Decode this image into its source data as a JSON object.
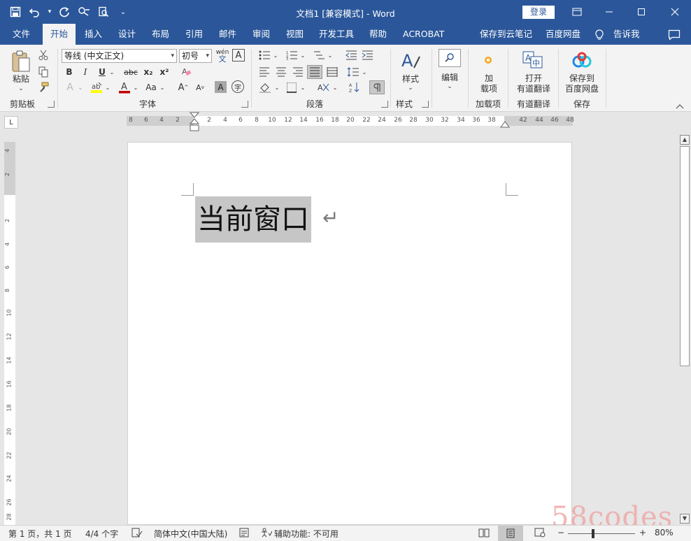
{
  "titlebar": {
    "title": "文档1 [兼容模式]  -  Word",
    "login_label": "登录",
    "qat_icons": [
      "save-icon",
      "undo-icon",
      "redo-icon",
      "touch-mode-icon",
      "print-preview-icon",
      "customize-qat-icon"
    ]
  },
  "tabs": [
    "文件",
    "开始",
    "插入",
    "设计",
    "布局",
    "引用",
    "邮件",
    "审阅",
    "视图",
    "开发工具",
    "帮助",
    "ACROBAT",
    "保存到云笔记",
    "百度网盘",
    "告诉我"
  ],
  "active_tab": "开始",
  "ribbon": {
    "clipboard": {
      "label": "剪贴板",
      "paste_label": "粘贴"
    },
    "font": {
      "label": "字体",
      "font_name": "等线 (中文正文)",
      "font_size": "初号",
      "bold": "B",
      "italic": "I",
      "underline": "U",
      "strike": "abc",
      "subscript": "x₂",
      "superscript": "x²",
      "change_case": "Aa",
      "grow": "A",
      "shrink": "A",
      "phonetic": "wén",
      "char_border": "A",
      "char_shade": "A",
      "enclose": "字"
    },
    "paragraph": {
      "label": "段落"
    },
    "styles": {
      "label": "样式",
      "button": "样式"
    },
    "editing": {
      "label": "编辑"
    },
    "addins": {
      "label": "加载项",
      "button_line1": "加",
      "button_line2": "载项"
    },
    "youdao": {
      "label": "有道翻译",
      "button_line1": "打开",
      "button_line2": "有道翻译"
    },
    "save": {
      "label": "保存",
      "button_line1": "保存到",
      "button_line2": "百度网盘"
    }
  },
  "ruler": {
    "tab_selector": "L",
    "h_numbers": [
      "8",
      "6",
      "4",
      "2",
      "2",
      "4",
      "6",
      "8",
      "10",
      "12",
      "14",
      "16",
      "18",
      "20",
      "22",
      "24",
      "26",
      "28",
      "30",
      "32",
      "34",
      "36",
      "38",
      "42",
      "44",
      "46",
      "48"
    ],
    "v_numbers": [
      "4",
      "2",
      "2",
      "4",
      "6",
      "8",
      "10",
      "12",
      "14",
      "16",
      "18",
      "20",
      "22",
      "24",
      "26",
      "28"
    ]
  },
  "document": {
    "text": "当前窗口",
    "paragraph_mark": "↵"
  },
  "status": {
    "page": "第 1 页，共 1 页",
    "words": "4/4 个字",
    "language": "简体中文(中国大陆)",
    "accessibility": "辅助功能: 不可用",
    "zoom_minus": "−",
    "zoom_plus": "+",
    "zoom_level": "80%",
    "zoom_fraction": 0.8
  },
  "watermark": "58codes",
  "colors": {
    "accent": "#2b579a",
    "ribbon_bg": "#f3f3f3",
    "selection": "#c6c6c6"
  }
}
